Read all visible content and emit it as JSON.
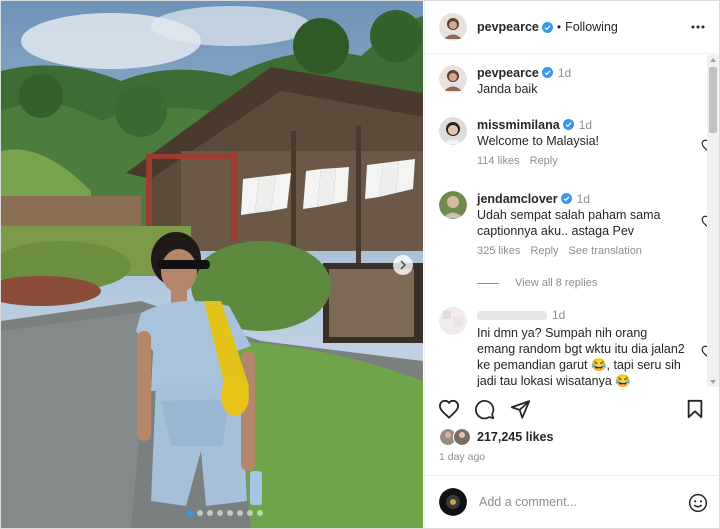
{
  "post": {
    "author": "pevpearce",
    "follow_status": "Following",
    "bullet": "•",
    "carousel_dots": 8,
    "carousel_active": 0
  },
  "comments": [
    {
      "user": "pevpearce",
      "time": "1d",
      "text": "Janda baik",
      "verified": true
    },
    {
      "user": "missmimilana",
      "time": "1d",
      "text": "Welcome to Malaysia!",
      "likes": "114 likes",
      "reply": "Reply",
      "verified": true
    },
    {
      "user": "jendamclover",
      "time": "1d",
      "text": "Udah sempat salah paham sama captionnya aku.. astaga Pev",
      "likes": "325 likes",
      "reply": "Reply",
      "translation": "See translation",
      "verified": true
    },
    {
      "user": "",
      "time": "1d",
      "text": "Ini dmn ya? Sumpah nih orang emang random bgt wktu itu dia jalan2 ke pemandian garut 😂, tapi seru sih jadi tau lokasi wisatanya 😂"
    }
  ],
  "view_replies": "View all 8 replies",
  "likes_total": "217,245 likes",
  "time_ago": "1 day ago",
  "add_comment_placeholder": "Add a comment...",
  "colors": {
    "verified": "#3897f0",
    "muted": "#8e8e8e",
    "text": "#262626"
  }
}
